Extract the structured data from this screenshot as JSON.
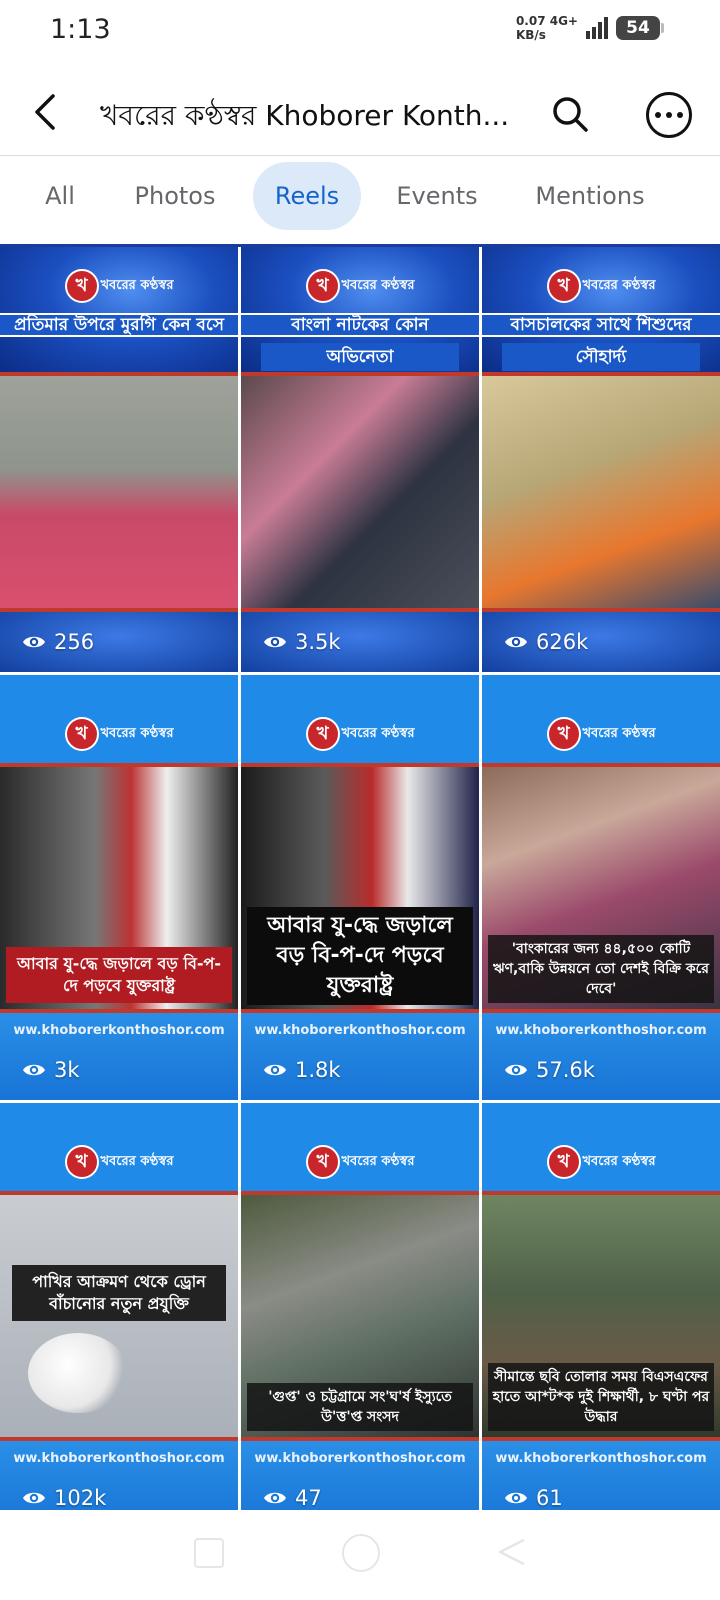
{
  "status_bar": {
    "time": "1:13",
    "net_speed_value": "0.07",
    "net_speed_unit": "KB/s",
    "network_type": "4G+",
    "battery": "54"
  },
  "header": {
    "title": "খবরের কণ্ঠস্বর Khoborer Konth..."
  },
  "tabs": [
    {
      "label": "All",
      "active": false
    },
    {
      "label": "Photos",
      "active": false
    },
    {
      "label": "Reels",
      "active": true
    },
    {
      "label": "Events",
      "active": false
    },
    {
      "label": "Mentions",
      "active": false
    }
  ],
  "brand": {
    "logo_text": "খবরের কণ্ঠস্বর",
    "website": "ww.khoborerkonthoshor.com",
    "accent_color": "#1464cc",
    "brand_red": "#c9262c"
  },
  "reels": [
    {
      "headline": "প্রতিমার উপরে মুরগি কেন বসে",
      "headline2": "",
      "views": "256"
    },
    {
      "headline": "বাংলা নাটকের কোন",
      "headline2": "অভিনেতা",
      "views": "3.5k"
    },
    {
      "headline": "বাসচালকের সাথে শিশুদের",
      "headline2": "সৌহার্দ্য",
      "views": "626k"
    },
    {
      "caption": "আবার যু-দ্ধে জড়ালে বড় বি-প-দে পড়বে যুক্তরাষ্ট্র",
      "views": "3k"
    },
    {
      "caption": "আবার যু-দ্ধে জড়ালে বড় বি-প-দে পড়বে যুক্তরাষ্ট্র",
      "views": "1.8k"
    },
    {
      "caption": "'বাংকারের জন্য ৪৪,৫০০ কোটি ঋণ,বাকি উন্নয়নে তো দেশই বিক্রি করে দেবে'",
      "views": "57.6k"
    },
    {
      "caption": "পাখির আক্রমণ থেকে ড্রোন বাঁচানোর নতুন প্রযুক্তি",
      "views": "102k"
    },
    {
      "caption": "'গুপ্ত' ও চট্টগ্রামে সং'ঘ'র্ষ ইস্যুতে উ'ত্ত'প্ত সংসদ",
      "views": "47"
    },
    {
      "caption": "সীমান্তে ছবি তোলার সময় বিএসএফের হাতে আ*ট*ক দুই শিক্ষার্থী, ৮ ঘণ্টা পর উদ্ধার",
      "views": "61"
    }
  ]
}
